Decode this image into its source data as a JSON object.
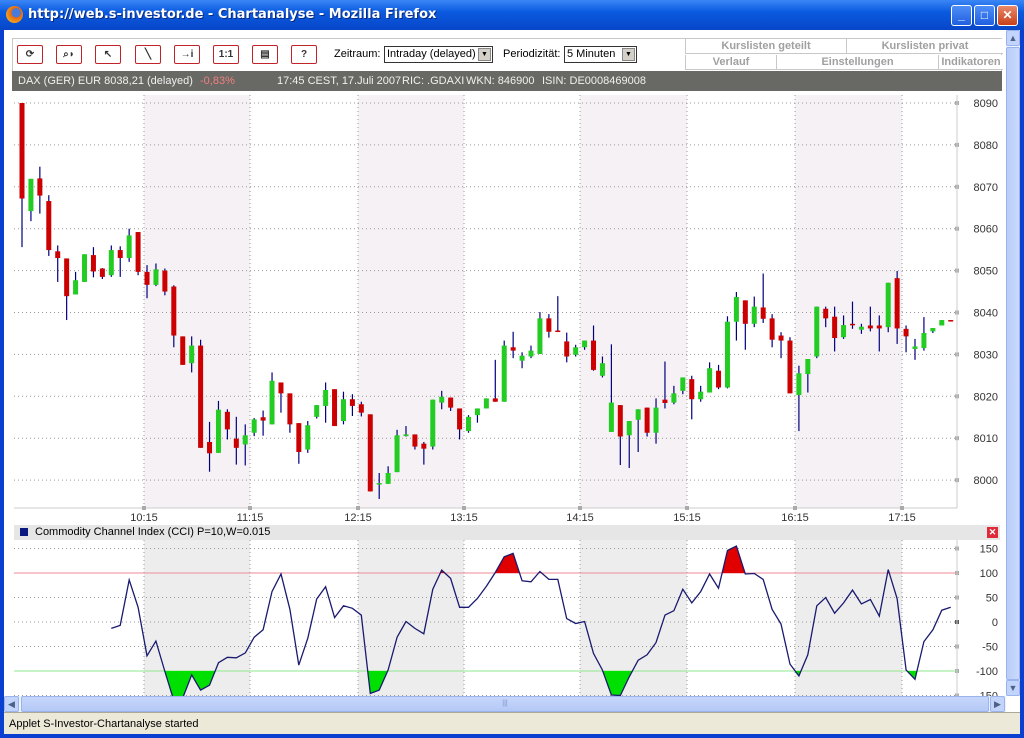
{
  "window": {
    "title": "http://web.s-investor.de - Chartanalyse - Mozilla Firefox",
    "min": "_",
    "max": "□",
    "close": "✕"
  },
  "toolbar": {
    "buttons": [
      {
        "name": "refresh",
        "glyph": "⟳"
      },
      {
        "name": "zoom",
        "glyph": "⌕◗"
      },
      {
        "name": "pointer",
        "glyph": "↖"
      },
      {
        "name": "trendline",
        "glyph": "╲"
      },
      {
        "name": "info",
        "glyph": "→i"
      },
      {
        "name": "reset-scale",
        "glyph": "1:1"
      },
      {
        "name": "print",
        "glyph": "▤"
      },
      {
        "name": "help",
        "glyph": "?"
      }
    ],
    "zeitraum_label": "Zeitraum:",
    "zeitraum_value": "Intraday (delayed)",
    "periodizitaet_label": "Periodizität:",
    "periodizitaet_value": "5 Minuten"
  },
  "tabs": {
    "row1": [
      "Kurslisten geteilt",
      "Kurslisten privat"
    ],
    "row2": [
      "Verlauf",
      "Einstellungen",
      "Indikatoren"
    ]
  },
  "info": {
    "instrument": "DAX (GER) EUR 8038,21 (delayed)",
    "change": "-0,83%",
    "time": "17:45 CEST, 17.Juli 2007",
    "ric": "RIC: .GDAXI",
    "wkn": "WKN: 846900",
    "isin": "ISIN: DE0008469008",
    "change_color": "#f08080"
  },
  "cci_panel": {
    "label": "Commodity Channel Index (CCI) P=10,W=0.015",
    "close": "✕"
  },
  "status": "Applet S-Investor-Chartanalyse started",
  "colors": {
    "up": "#22cc22",
    "down": "#cc0000",
    "wick": "#000080",
    "cci_line": "#1a1a70",
    "overbought": "#e00000",
    "oversold": "#00e000"
  },
  "chart_data": [
    {
      "type": "candlestick",
      "title": "DAX 5 Minuten Intraday",
      "interval": "5 min",
      "first_bar": "09:00",
      "ylim": [
        7994,
        8091
      ],
      "yticks": [
        8000,
        8010,
        8020,
        8030,
        8040,
        8050,
        8060,
        8070,
        8080,
        8090
      ],
      "xticks": [
        "10:15",
        "11:15",
        "12:15",
        "13:15",
        "14:15",
        "15:15",
        "16:15",
        "17:15"
      ],
      "ohlc": [
        [
          8090,
          8090,
          8055.6,
          8067.2
        ],
        [
          8064.2,
          8071.9,
          8061.8,
          8071.9
        ],
        [
          8072,
          8074.8,
          8063.6,
          8067.9
        ],
        [
          8066.6,
          8068,
          8053.5,
          8054.9
        ],
        [
          8054.6,
          8056,
          8047.3,
          8053
        ],
        [
          8052.9,
          8052.9,
          8038.2,
          8043.9
        ],
        [
          8044.3,
          8049.7,
          8044.3,
          8047.7
        ],
        [
          8047.3,
          8053.9,
          8047.3,
          8053.9
        ],
        [
          8053.7,
          8055.6,
          8048.4,
          8049.8
        ],
        [
          8050.5,
          8050.6,
          8048,
          8048.5
        ],
        [
          8048.9,
          8056,
          8048.5,
          8054.9
        ],
        [
          8054.9,
          8055.8,
          8048.5,
          8053
        ],
        [
          8053,
          8060,
          8052.1,
          8058.4
        ],
        [
          8059.2,
          8059.2,
          8048.9,
          8049.7
        ],
        [
          8049.7,
          8051.3,
          8043.4,
          8046.6
        ],
        [
          8046.6,
          8051.7,
          8046.3,
          8050.3
        ],
        [
          8050,
          8050.5,
          8044.1,
          8045
        ],
        [
          8046.2,
          8046.5,
          8031.7,
          8034.5
        ],
        [
          8034.3,
          8034.3,
          8027.5,
          8027.5
        ],
        [
          8027.9,
          8034.3,
          8025.7,
          8032.1
        ],
        [
          8032.1,
          8033.5,
          8007.7,
          8007.7
        ],
        [
          8009.1,
          8013.9,
          8002,
          8006.4
        ],
        [
          8006.5,
          8018.9,
          8006.5,
          8016.8
        ],
        [
          8016.3,
          8016.9,
          8009.7,
          8012.1
        ],
        [
          8009.9,
          8015.1,
          8003.7,
          8007.7
        ],
        [
          8008.5,
          8013.3,
          8003.5,
          8010.7
        ],
        [
          8011.3,
          8014.8,
          8010.5,
          8014.5
        ],
        [
          8015,
          8016.6,
          8010.6,
          8014.2
        ],
        [
          8013.3,
          8025.7,
          8013.3,
          8023.7
        ],
        [
          8023.3,
          8023.3,
          8016.1,
          8020.7
        ],
        [
          8020.7,
          8020.7,
          8011.3,
          8013.3
        ],
        [
          8013.6,
          8013.6,
          8003.9,
          8006.7
        ],
        [
          8007.3,
          8014.1,
          8006.5,
          8013.1
        ],
        [
          8015.1,
          8017.9,
          8014.7,
          8017.9
        ],
        [
          8017.7,
          8023.3,
          8013.7,
          8021.5
        ],
        [
          8021.7,
          8021.7,
          8012.9,
          8012.9
        ],
        [
          8014.1,
          8021.1,
          8013.3,
          8019.3
        ],
        [
          8019.3,
          8020.5,
          8015.3,
          8017.7
        ],
        [
          8018.1,
          8018.7,
          8015.2,
          8016.1
        ],
        [
          8015.7,
          8015.7,
          7997.3,
          7997.3
        ],
        [
          7999.1,
          8001.7,
          7995.5,
          7999.3
        ],
        [
          7999.1,
          8003.3,
          7999.1,
          8001.7
        ],
        [
          8001.9,
          8012,
          8001.9,
          8010.7
        ],
        [
          8010.5,
          8012.9,
          8010.4,
          8010.9
        ],
        [
          8010.9,
          8010.9,
          8007.3,
          8008
        ],
        [
          8008.7,
          8009.1,
          8003.7,
          8007.5
        ],
        [
          8008,
          8019.2,
          8007.3,
          8019.2
        ],
        [
          8018.5,
          8021.3,
          8016.9,
          8019.9
        ],
        [
          8019.7,
          8019.7,
          8016.5,
          8017.3
        ],
        [
          8017.1,
          8017.1,
          8009.7,
          8012.1
        ],
        [
          8011.7,
          8015.5,
          8011.3,
          8015.1
        ],
        [
          8015.5,
          8017.1,
          8013.7,
          8017.1
        ],
        [
          8017.1,
          8019.5,
          8017.1,
          8019.5
        ],
        [
          8019.5,
          8028.7,
          8018.7,
          8018.7
        ],
        [
          8018.7,
          8033.3,
          8018.7,
          8032.1
        ],
        [
          8031.7,
          8035.4,
          8029.1,
          8030.9
        ],
        [
          8028.5,
          8030.5,
          8026.7,
          8029.7
        ],
        [
          8029.5,
          8032.1,
          8029.1,
          8030.9
        ],
        [
          8030.1,
          8040.1,
          8030.1,
          8038.6
        ],
        [
          8038.6,
          8039.6,
          8034,
          8035.4
        ],
        [
          8035.7,
          8043.9,
          8035.5,
          8035.5
        ],
        [
          8033.1,
          8035.2,
          8028.1,
          8029.5
        ],
        [
          8029.9,
          8032.3,
          8029.5,
          8031.7
        ],
        [
          8031.7,
          8033.3,
          8031.1,
          8033.3
        ],
        [
          8033.3,
          8036.9,
          8026.1,
          8026.3
        ],
        [
          8024.9,
          8029.5,
          8024.5,
          8027.9
        ],
        [
          8011.5,
          8032.4,
          8011.5,
          8018.5
        ],
        [
          8017.9,
          8017.9,
          8003.6,
          8010.4
        ],
        [
          8010.7,
          8014.1,
          8002.9,
          8014.1
        ],
        [
          8014.4,
          8016.9,
          8006.7,
          8016.9
        ],
        [
          8017.3,
          8017.3,
          8010.4,
          8011.3
        ],
        [
          8011.3,
          8019.5,
          8008.7,
          8017.3
        ],
        [
          8019.2,
          8028.3,
          8017.1,
          8018.4
        ],
        [
          8018.5,
          8022.5,
          8018.1,
          8020.7
        ],
        [
          8021.3,
          8024.5,
          8020.5,
          8024.5
        ],
        [
          8024.1,
          8024.9,
          8014.5,
          8019.3
        ],
        [
          8019.3,
          8022.5,
          8018.7,
          8021.1
        ],
        [
          8020.9,
          8028.1,
          8020.9,
          8026.7
        ],
        [
          8026.1,
          8027.5,
          8021.7,
          8022.1
        ],
        [
          8022.1,
          8039.1,
          8021.9,
          8037.8
        ],
        [
          8037.8,
          8044.9,
          8033.3,
          8043.7
        ],
        [
          8042.9,
          8042.9,
          8031.1,
          8037.3
        ],
        [
          8037.3,
          8043.8,
          8036.5,
          8041.4
        ],
        [
          8041.2,
          8049.3,
          8037.5,
          8038.5
        ],
        [
          8038.6,
          8039.6,
          8031.7,
          8033.5
        ],
        [
          8034.5,
          8035.3,
          8029.1,
          8033.3
        ],
        [
          8033.3,
          8034.1,
          8020.7,
          8020.7
        ],
        [
          8020.3,
          8027.3,
          8011.7,
          8025.5
        ],
        [
          8025.3,
          8028.9,
          8020.9,
          8028.9
        ],
        [
          8029.5,
          8041.4,
          8029.1,
          8041.4
        ],
        [
          8040.9,
          8041.4,
          8036.5,
          8038.6
        ],
        [
          8039,
          8041.4,
          8030.7,
          8033.9
        ],
        [
          8034.1,
          8039.3,
          8033.7,
          8037
        ],
        [
          8037.3,
          8042.6,
          8036.1,
          8037
        ],
        [
          8035.9,
          8037.3,
          8034.9,
          8036.6
        ],
        [
          8036.9,
          8041.4,
          8035.5,
          8036.2
        ],
        [
          8036.9,
          8039.3,
          8030.7,
          8036.2
        ],
        [
          8036.5,
          8047.1,
          8035.3,
          8047.1
        ],
        [
          8048.2,
          8049.9,
          8032.5,
          8036.2
        ],
        [
          8036.1,
          8036.9,
          8030.5,
          8034.3
        ],
        [
          8031.3,
          8033.7,
          8028.7,
          8031.9
        ],
        [
          8031.5,
          8038.9,
          8030.9,
          8035.1
        ],
        [
          8035.5,
          8036.3,
          8035.1,
          8036.3
        ],
        [
          8036.9,
          8038.2,
          8036.9,
          8038.2
        ],
        [
          8038.2,
          8038.2,
          8038.1,
          8038.1
        ]
      ]
    },
    {
      "type": "line",
      "title": "Commodity Channel Index (CCI) P=10,W=0.015",
      "start_bar": 11,
      "ylim": [
        -150,
        160
      ],
      "yticks": [
        150,
        100,
        50,
        0,
        -50,
        -100,
        -150
      ],
      "thresholds": [
        100,
        -100
      ],
      "values": [
        -13,
        -7,
        86,
        30,
        -69,
        -39,
        -101,
        -160,
        -155,
        -108,
        -139,
        -129,
        -83,
        -72,
        -73,
        -63,
        -31,
        -16,
        62,
        98,
        26,
        -88,
        -33,
        47,
        72,
        9,
        33,
        28,
        14,
        -146,
        -139,
        -98,
        -31,
        1,
        -13,
        -24,
        67,
        106,
        89,
        30,
        30,
        48,
        73,
        101,
        133,
        140,
        84,
        82,
        103,
        87,
        87,
        7,
        -3,
        1,
        -64,
        -98,
        -149,
        -150,
        -112,
        -78,
        -67,
        -42,
        14,
        23,
        67,
        39,
        62,
        98,
        69,
        146,
        155,
        98,
        99,
        87,
        26,
        -4,
        -86,
        -110,
        -67,
        33,
        50,
        18,
        39,
        65,
        37,
        46,
        12,
        107,
        48,
        -98,
        -117,
        -40,
        -16,
        24,
        30
      ]
    }
  ]
}
